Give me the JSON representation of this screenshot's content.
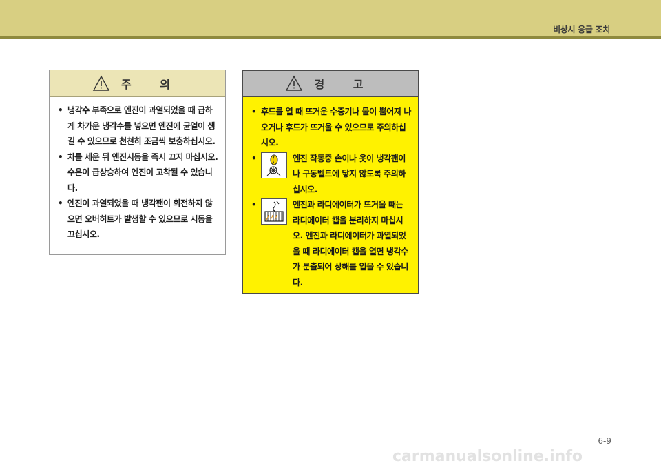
{
  "header": {
    "section_title": "비상시 응급 조치"
  },
  "caution": {
    "title": "주  의",
    "icon": "warning-triangle-icon",
    "items": [
      "냉각수 부족으로 엔진이 과열되었을 때 급하게 차가운 냉각수를 넣으면 엔진에 균열이 생길 수 있으므로 천천히 조금씩 보충하십시오.",
      "차를 세운 뒤 엔진시동을 즉시 끄지 마십시오. 수온이 급상승하여 엔진이 고착될 수 있습니다.",
      "엔진이 과열되었을 때 냉각팬이 회전하지 않으면 오버히트가 발생할 수 있으므로 시동을 끄십시오."
    ]
  },
  "warning": {
    "title": "경  고",
    "icon": "warning-triangle-icon",
    "items": [
      {
        "text": "후드를 열 때 뜨거운 수증기나 물이 뿜어져 나오거나 후드가 뜨거울 수 있으므로 주의하십시오."
      },
      {
        "text": "엔진 작동중 손이나 옷이 냉각팬이나 구동벨트에 닿지 않도록 주의하십시오.",
        "icon": "cooling-fan-hand-icon"
      },
      {
        "text": "엔진과 라디에이터가 뜨거울 때는 라디에이터 캡을 분리하지 마십시오. 엔진과 라디에이터가 과열되었을 때 라디에이터 캡을 열면 냉각수가 분출되어 상해를 입을 수 있습니다.",
        "icon": "hot-radiator-icon"
      }
    ]
  },
  "footer": {
    "page_number": "6-9",
    "watermark": "carmanualsonline.info"
  },
  "colors": {
    "header_band": "#d8cf82",
    "caution_header": "#ece5b6",
    "warning_background": "#fff200",
    "warning_header": "#bdbdbd"
  }
}
